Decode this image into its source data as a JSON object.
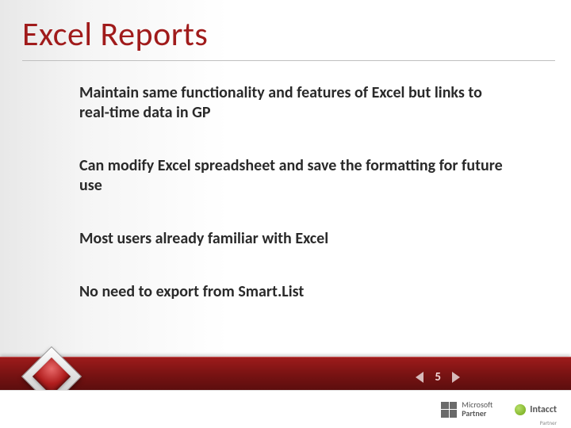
{
  "title": "Excel Reports",
  "bullets": [
    "Maintain same functionality and features of Excel but links to real-time data in GP",
    "Can modify Excel spreadsheet and save the formatting for future use",
    "Most users already familiar with Excel",
    "No need to export from Smart.List"
  ],
  "pager": {
    "current": "5"
  },
  "footer": {
    "ms": {
      "line1": "Microsoft",
      "line2": "Partner"
    },
    "intacct": {
      "name": "Intacct",
      "sub": "Partner"
    }
  }
}
